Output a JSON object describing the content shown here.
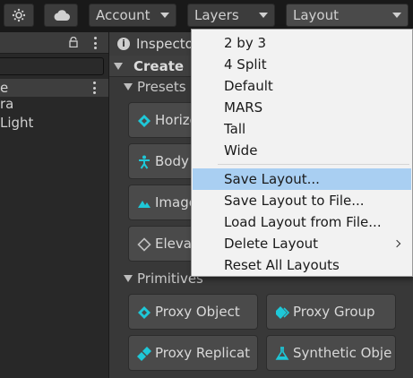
{
  "toolbar": {
    "account_label": "Account",
    "layers_label": "Layers",
    "layout_label": "Layout"
  },
  "hierarchy": {
    "scene_label": "e",
    "items": [
      "ra",
      "Light"
    ]
  },
  "inspector": {
    "tab_title": "Inspecto",
    "create_title": "Create",
    "presets_title": "Presets",
    "primitives_title": "Primitives",
    "presets": [
      {
        "label": "Horizo",
        "icon": "diamond-icon"
      },
      {
        "label": "Body",
        "icon": "body-icon"
      },
      {
        "label": "Image",
        "icon": "image-marker-icon"
      },
      {
        "label": "Eleva",
        "icon": "diamond-outline-icon"
      }
    ],
    "primitives": [
      {
        "label": "Proxy Object",
        "icon": "diamond-icon"
      },
      {
        "label": "Proxy Group",
        "icon": "proxy-group-icon"
      },
      {
        "label": "Proxy Replicat",
        "icon": "proxy-replicator-icon"
      },
      {
        "label": "Synthetic Obje",
        "icon": "flask-icon"
      }
    ]
  },
  "layout_menu": {
    "group1": [
      "2 by 3",
      "4 Split",
      "Default",
      "MARS",
      "Tall",
      "Wide"
    ],
    "group2": [
      "Save Layout...",
      "Save Layout to File...",
      "Load Layout from File...",
      "Delete Layout",
      "Reset All Layouts"
    ],
    "highlighted": "Save Layout..."
  },
  "colors": {
    "accent_icon": "#1ec8d8",
    "menu_highlight": "#a9cff2"
  }
}
